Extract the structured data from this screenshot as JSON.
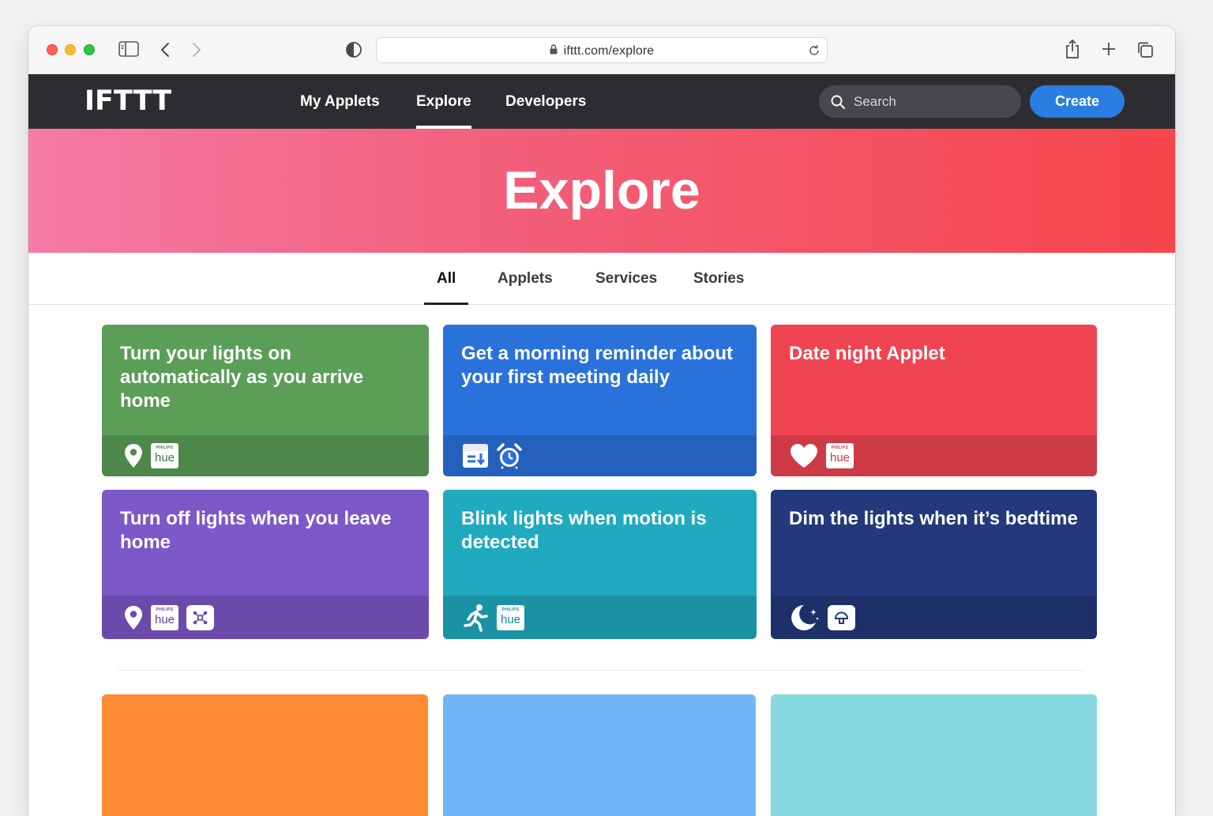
{
  "browser": {
    "url": "ifttt.com/explore"
  },
  "nav": {
    "logo": "IFTTT",
    "links": [
      "My Applets",
      "Explore",
      "Developers"
    ],
    "search_placeholder": "Search",
    "create_label": "Create"
  },
  "hero": {
    "title": "Explore"
  },
  "tabs": [
    "All",
    "Applets",
    "Services",
    "Stories"
  ],
  "cards": [
    {
      "title": "Turn your lights on automatically as you arrive home",
      "color": "#5a9e57",
      "icons": [
        "location-icon",
        "philips-hue-icon"
      ]
    },
    {
      "title": "Get a morning reminder about your first meeting daily",
      "color": "#2a72db",
      "icons": [
        "calendar-icon",
        "alarm-clock-icon"
      ]
    },
    {
      "title": "Date night Applet",
      "color": "#f04452",
      "icons": [
        "heart-icon",
        "philips-hue-icon"
      ]
    },
    {
      "title": "Turn off lights when you leave home",
      "color": "#7c58c9",
      "icons": [
        "location-icon",
        "philips-hue-icon",
        "smart-home-icon"
      ]
    },
    {
      "title": "Blink lights when motion is detected",
      "color": "#1faabf",
      "icons": [
        "motion-icon",
        "philips-hue-icon"
      ]
    },
    {
      "title": "Dim the lights when it’s bedtime",
      "color": "#23397c",
      "icons": [
        "moon-icon",
        "smart-bulb-icon"
      ]
    }
  ],
  "hue_badge": {
    "brand": "PHILIPS",
    "product": "hue"
  },
  "lower_cards": [
    {
      "color": "#fd8a35"
    },
    {
      "color": "#72b6f7"
    },
    {
      "color": "#86d9e0"
    }
  ]
}
